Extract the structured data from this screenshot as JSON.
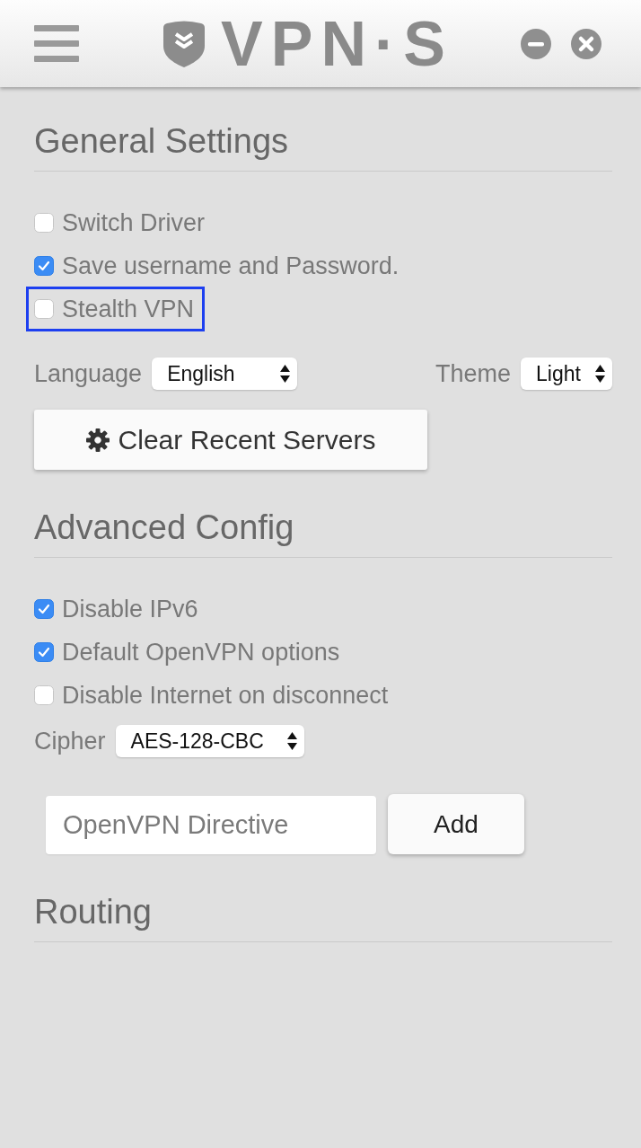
{
  "app_bar": {
    "logo_text": "VPN·S"
  },
  "sections": [
    {
      "title": "General Settings",
      "items": [
        {
          "kind": "checkbox",
          "label": "Switch Driver",
          "checked": false,
          "highlighted": false
        },
        {
          "kind": "checkbox",
          "label": "Save username and Password.",
          "checked": true,
          "highlighted": false
        },
        {
          "kind": "checkbox",
          "label": "Stealth VPN",
          "checked": false,
          "highlighted": true
        },
        {
          "kind": "selects",
          "fields": [
            {
              "label": "Language",
              "value": "English"
            },
            {
              "label": "Theme",
              "value": "Light"
            }
          ]
        },
        {
          "kind": "button",
          "label": "Clear Recent Servers"
        }
      ]
    },
    {
      "title": "Advanced Config",
      "items": [
        {
          "kind": "checkbox",
          "label": "Disable IPv6",
          "checked": true,
          "highlighted": false
        },
        {
          "kind": "checkbox",
          "label": "Default OpenVPN options",
          "checked": true,
          "highlighted": false
        },
        {
          "kind": "checkbox",
          "label": "Disable Internet on disconnect",
          "checked": false,
          "highlighted": false
        },
        {
          "kind": "selects",
          "fields": [
            {
              "label": "Cipher",
              "value": "AES-128-CBC"
            }
          ]
        },
        {
          "kind": "entry",
          "placeholder": "OpenVPN Directive",
          "button": "Add"
        }
      ]
    },
    {
      "title": "Routing"
    }
  ]
}
